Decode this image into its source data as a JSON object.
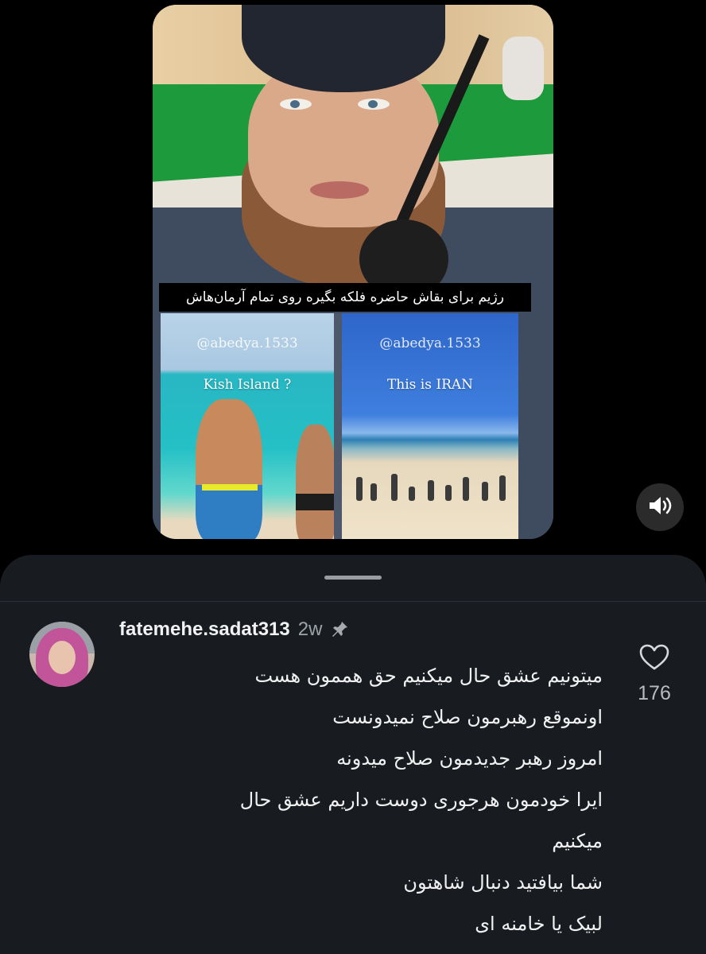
{
  "video": {
    "caption": "رژیم برای بقاش حاضره فلکه بگیره روی تمام آرمان‌هاش",
    "left_panel": {
      "handle": "@abedya.1533",
      "title": "Kish Island ?"
    },
    "right_panel": {
      "handle": "@abedya.1533",
      "title": "This is IRAN"
    },
    "sound_icon": "speaker-icon"
  },
  "comment": {
    "username": "fatemehe.sadat313",
    "time": "2w",
    "pinned_icon": "pin-icon",
    "lines": [
      "میتونیم عشق حال میکنیم حق هممون هست",
      "اونموقع رهبرمون صلاح نمیدونست",
      "امروز رهبر جدیدمون صلاح میدونه",
      "ایرا خودمون هرجوری دوست داریم عشق حال",
      "میکنیم",
      "شما بیافتید دنبال شاهتون",
      "لبیک یا خامنه ای"
    ],
    "like_icon": "heart-icon",
    "like_count": "176"
  },
  "colors": {
    "sheet_background": "#181c21",
    "text_primary": "#f2f2f2",
    "text_secondary": "#9ea3a8"
  }
}
